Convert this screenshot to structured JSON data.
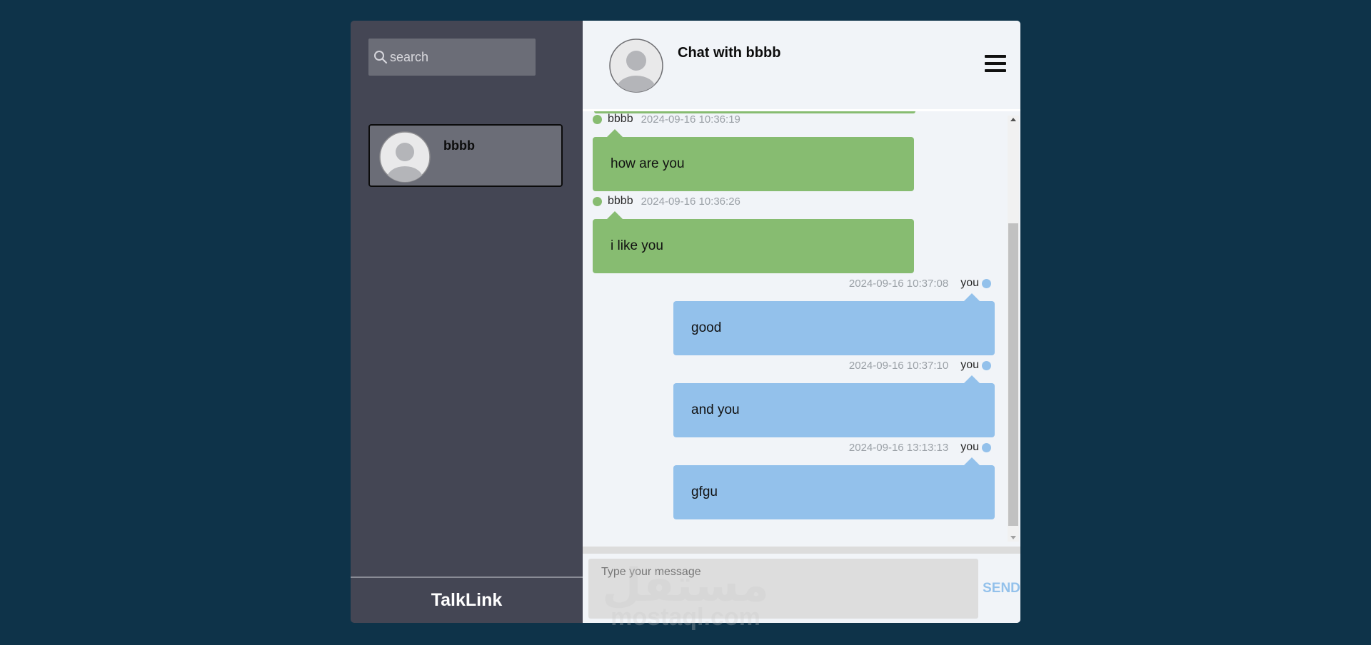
{
  "sidebar": {
    "search": {
      "placeholder": "search",
      "value": ""
    },
    "contacts": [
      {
        "name": "bbbb",
        "selected": true
      }
    ],
    "brand": "TalkLink"
  },
  "chat": {
    "title": "Chat with bbbb",
    "messages": [
      {
        "direction": "in",
        "sender": "bbbb",
        "time": "2024-09-16 10:36:19",
        "text": "how are you"
      },
      {
        "direction": "in",
        "sender": "bbbb",
        "time": "2024-09-16 10:36:26",
        "text": "i like you"
      },
      {
        "direction": "out",
        "sender": "you",
        "time": "2024-09-16 10:37:08",
        "text": "good"
      },
      {
        "direction": "out",
        "sender": "you",
        "time": "2024-09-16 10:37:10",
        "text": "and you"
      },
      {
        "direction": "out",
        "sender": "you",
        "time": "2024-09-16 13:13:13",
        "text": "gfgu"
      }
    ]
  },
  "composer": {
    "placeholder": "Type your message",
    "value": "",
    "send_label": "SEND"
  },
  "watermark": {
    "arabic": "مستقل",
    "latin": "mostaql.com"
  },
  "colors": {
    "background": "#0e3349",
    "sidebar": "#444654",
    "incoming_bubble": "#87bc71",
    "outgoing_bubble": "#93c1eb",
    "send_text": "#93c1eb"
  },
  "icons": {
    "search": "search-icon",
    "avatar": "avatar-placeholder-icon",
    "menu": "hamburger-menu-icon"
  }
}
